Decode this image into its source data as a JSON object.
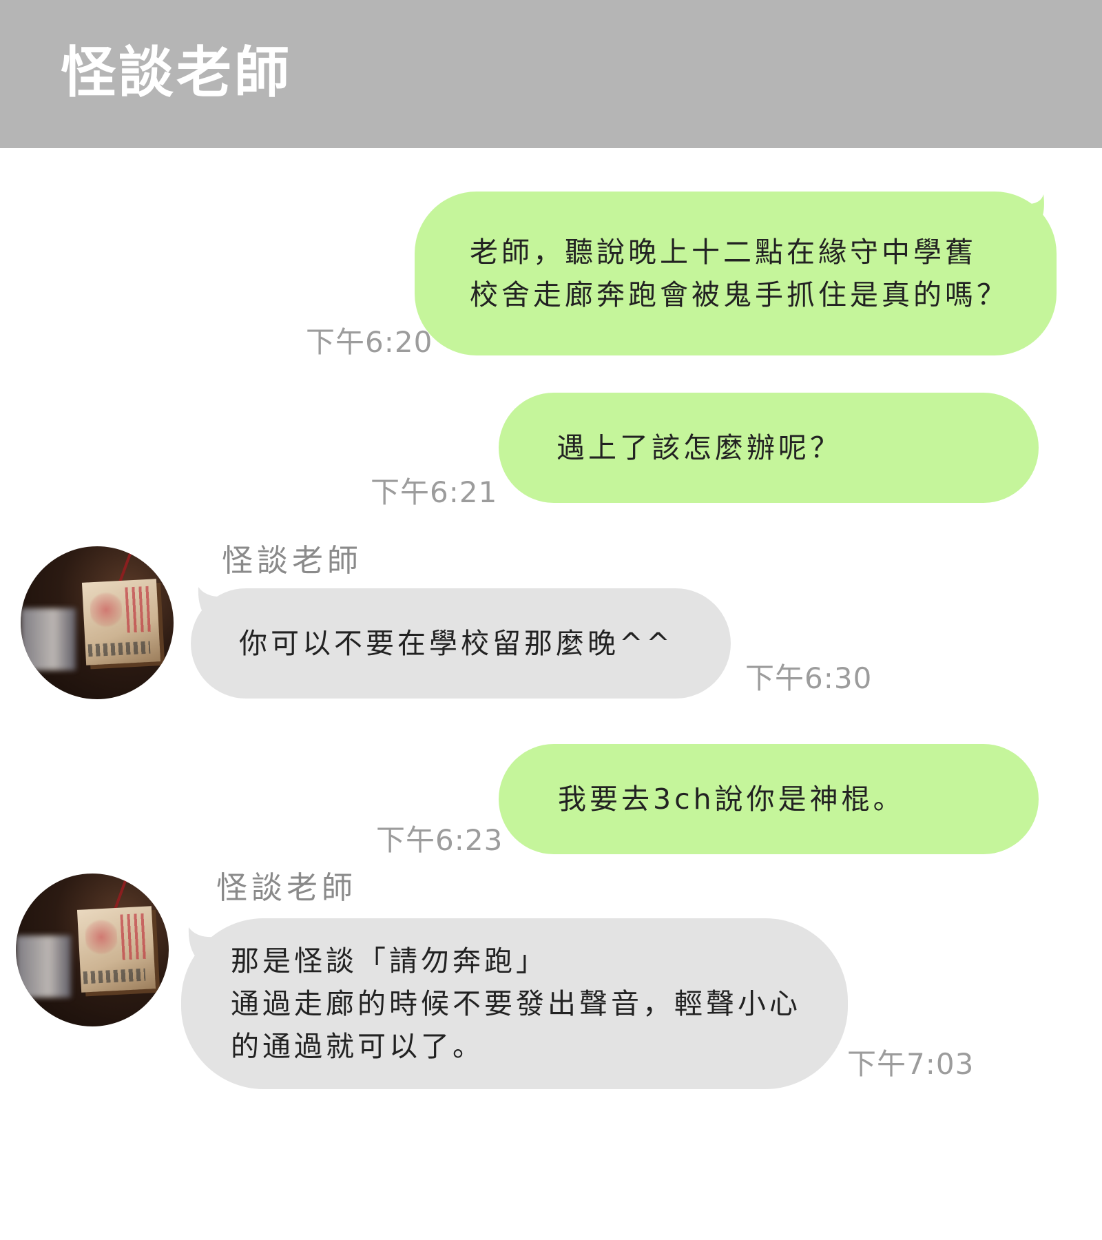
{
  "header": {
    "title": "怪談老師"
  },
  "messages": [
    {
      "sender": "",
      "text": "老師，聽說晚上十二點在緣守中學舊\n校舍走廊奔跑會被鬼手抓住是真的嗎？",
      "time": "下午6:20"
    },
    {
      "sender": "",
      "text": "遇上了該怎麼辦呢？",
      "time": "下午6:21"
    },
    {
      "sender": "怪談老師",
      "text": "你可以不要在學校留那麼晚^^",
      "time": "下午6:30"
    },
    {
      "sender": "",
      "text": "我要去3ch說你是神棍。",
      "time": "下午6:23"
    },
    {
      "sender": "怪談老師",
      "text": "那是怪談「請勿奔跑」\n通過走廊的時候不要發出聲音，輕聲小心\n的通過就可以了。",
      "time": "下午7:03"
    }
  ],
  "colors": {
    "header_bg": "#b5b5b5",
    "outgoing_bubble": "#c5f59b",
    "incoming_bubble": "#e3e3e3",
    "timestamp": "#9c9c9c"
  }
}
